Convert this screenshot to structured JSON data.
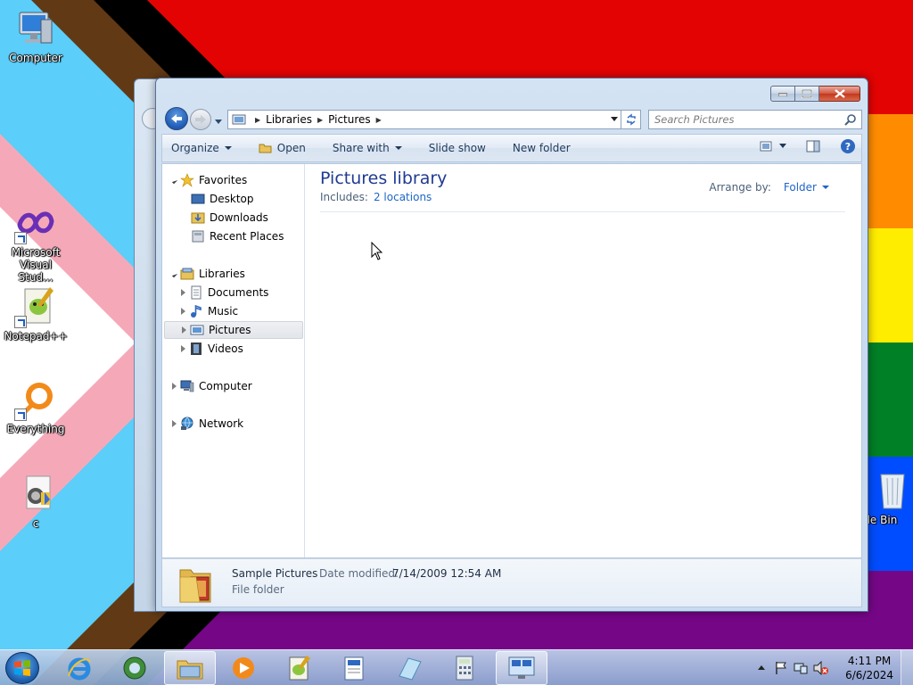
{
  "desktop": {
    "icons": [
      {
        "label": "Computer"
      },
      {
        "label": "Microsoft Visual Stud..."
      },
      {
        "label": "Notepad++"
      },
      {
        "label": "Everything"
      },
      {
        "label": "c"
      },
      {
        "label": "cle Bin"
      }
    ]
  },
  "window": {
    "breadcrumb": [
      "Libraries",
      "Pictures"
    ],
    "search_placeholder": "Search Pictures",
    "toolbar": {
      "organize": "Organize",
      "open": "Open",
      "share_with": "Share with",
      "slide_show": "Slide show",
      "new_folder": "New folder"
    },
    "nav": {
      "favorites": "Favorites",
      "desktop": "Desktop",
      "downloads": "Downloads",
      "recent_places": "Recent Places",
      "libraries": "Libraries",
      "documents": "Documents",
      "music": "Music",
      "pictures": "Pictures",
      "videos": "Videos",
      "computer": "Computer",
      "network": "Network"
    },
    "library": {
      "title": "Pictures library",
      "includes_label": "Includes:",
      "includes_link": "2 locations",
      "arrange_label": "Arrange by:",
      "arrange_value": "Folder"
    },
    "details": {
      "name": "Sample Pictures",
      "modified_label": "Date modified:",
      "modified_value": "7/14/2009 12:54 AM",
      "kind": "File folder"
    }
  },
  "taskbar": {
    "time": "4:11 PM",
    "date": "6/6/2024"
  },
  "colors": {
    "accent": "#1e66c8",
    "title_text": "#1f3a93",
    "taskbar": "#a8c0dd"
  }
}
